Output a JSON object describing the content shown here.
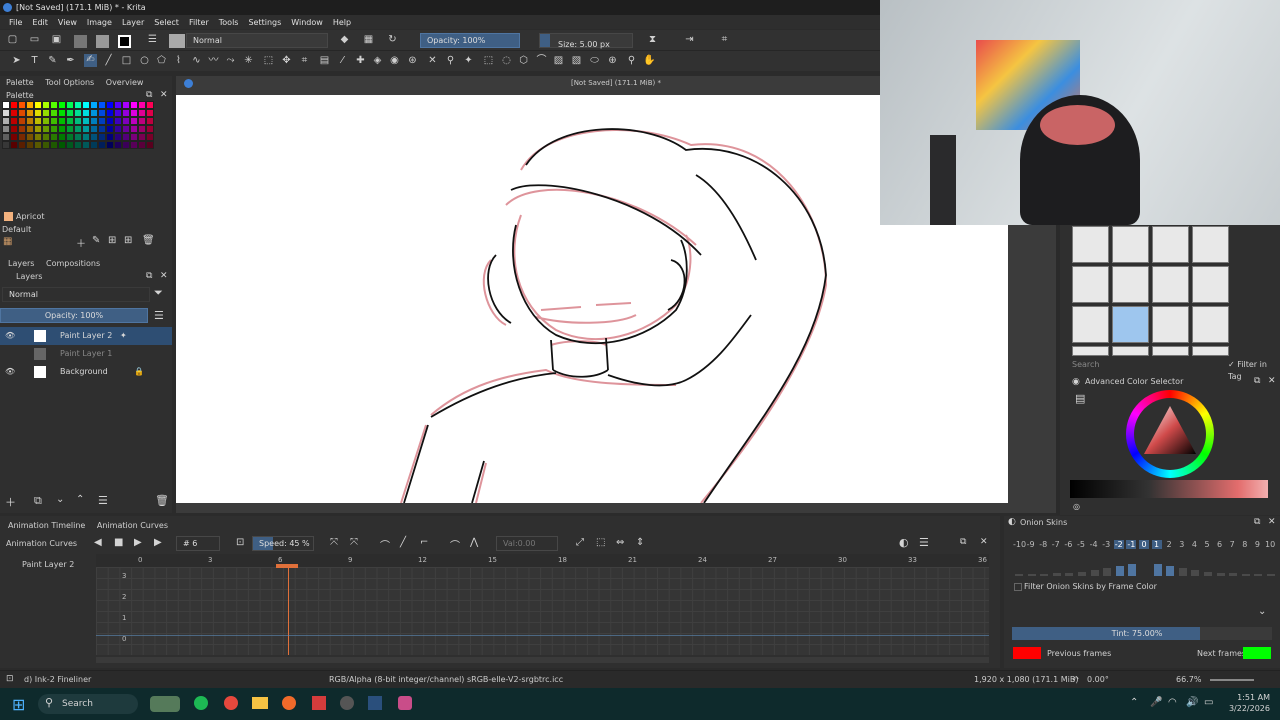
{
  "window": {
    "title": "[Not Saved]  (171.1 MiB) * - Krita"
  },
  "menu": [
    "File",
    "Edit",
    "View",
    "Image",
    "Layer",
    "Select",
    "Filter",
    "Tools",
    "Settings",
    "Window",
    "Help"
  ],
  "toolbar": {
    "blend_mode": "Normal",
    "opacity": "Opacity: 100%",
    "size": "Size: 5.00 px"
  },
  "left_dock": {
    "tabs": [
      "Palette",
      "Tool Options",
      "Overview"
    ],
    "palette_title": "Palette",
    "swatch_name": "Apricot",
    "palette_name": "Default",
    "palette_colors": [
      "#ffffff",
      "#ff0000",
      "#ff5500",
      "#ffaa00",
      "#ffff00",
      "#aaff00",
      "#55ff00",
      "#00ff00",
      "#00ff55",
      "#00ffaa",
      "#00ffff",
      "#00aaff",
      "#0055ff",
      "#0000ff",
      "#5500ff",
      "#aa00ff",
      "#ff00ff",
      "#ff00aa",
      "#ff0055"
    ],
    "layers_tabs": [
      "Layers",
      "Compositions"
    ],
    "layers_title": "Layers",
    "layer_blend": "Normal",
    "layer_opacity": "Opacity:  100%",
    "layers": [
      {
        "name": "Paint Layer 2",
        "selected": true
      },
      {
        "name": "Paint Layer 1",
        "selected": false
      },
      {
        "name": "Background",
        "selected": false
      }
    ]
  },
  "canvas": {
    "doc_title": "[Not Saved]  (171.1 MiB) *"
  },
  "right_dock": {
    "search_placeholder": "Search",
    "filter_in_tag": "Filter in Tag",
    "color_selector_title": "Advanced Color Selector"
  },
  "timeline": {
    "tabs": [
      "Animation Timeline",
      "Animation Curves"
    ],
    "title": "Animation Curves",
    "frame": "# 6",
    "speed": "Speed: 45 %",
    "value": "Val:0.00",
    "channel": "Paint Layer 2",
    "ticks": [
      "0",
      "3",
      "6",
      "9",
      "12",
      "15",
      "18",
      "21",
      "24",
      "27",
      "30",
      "33",
      "36"
    ],
    "y_ticks": [
      "3",
      "2",
      "1",
      "0"
    ]
  },
  "onion": {
    "title": "Onion Skins",
    "numbers": [
      "-10",
      "-9",
      "-8",
      "-7",
      "-6",
      "-5",
      "-4",
      "-3",
      "-2",
      "-1",
      "0",
      "1",
      "2",
      "3",
      "4",
      "5",
      "6",
      "7",
      "8",
      "9",
      "10"
    ],
    "filter_label": "Filter Onion Skins by Frame Color",
    "tint": "Tint: 75.00%",
    "previous": "Previous frames",
    "next": "Next frames",
    "previous_color": "#ff0000",
    "next_color": "#00ff00"
  },
  "status": {
    "brush": "d) Ink-2 Fineliner",
    "color_space": "RGB/Alpha (8-bit integer/channel)  sRGB-elle-V2-srgbtrc.icc",
    "dimensions": "1,920 x 1,080 (171.1 MiB)",
    "rotation": "0.00°",
    "zoom": "66.7%"
  },
  "taskbar": {
    "search": "Search",
    "time": "1:51 AM",
    "date": "3/22/2026"
  }
}
